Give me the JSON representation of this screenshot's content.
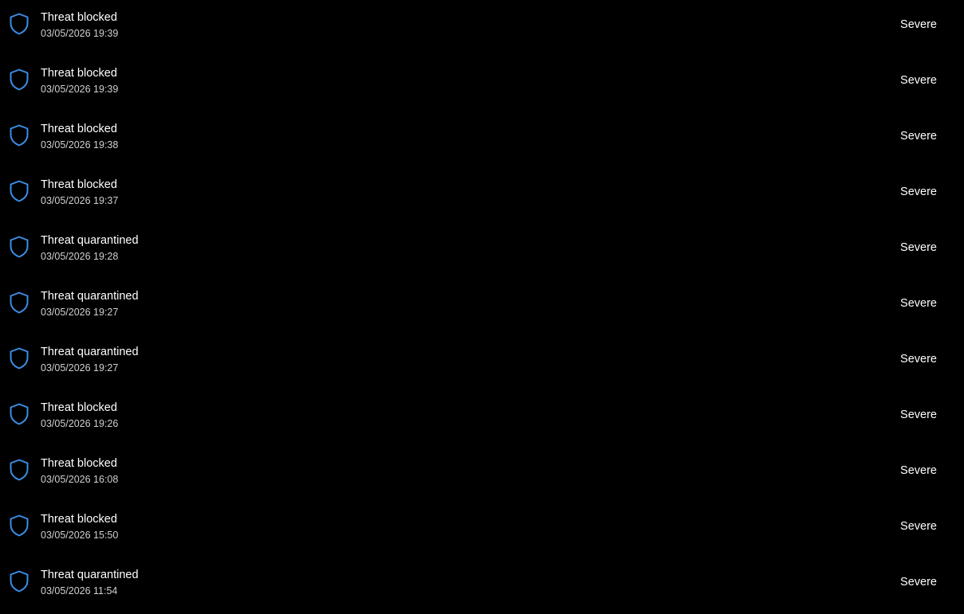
{
  "colors": {
    "background": "#000000",
    "text": "#ffffff",
    "subtext": "#d0d0d0",
    "shield": "#3a8ee6"
  },
  "history": {
    "items": [
      {
        "icon": "shield-icon",
        "title": "Threat blocked",
        "timestamp": "03/05/2026 19:39",
        "severity": "Severe"
      },
      {
        "icon": "shield-icon",
        "title": "Threat blocked",
        "timestamp": "03/05/2026 19:39",
        "severity": "Severe"
      },
      {
        "icon": "shield-icon",
        "title": "Threat blocked",
        "timestamp": "03/05/2026 19:38",
        "severity": "Severe"
      },
      {
        "icon": "shield-icon",
        "title": "Threat blocked",
        "timestamp": "03/05/2026 19:37",
        "severity": "Severe"
      },
      {
        "icon": "shield-icon",
        "title": "Threat quarantined",
        "timestamp": "03/05/2026 19:28",
        "severity": "Severe"
      },
      {
        "icon": "shield-icon",
        "title": "Threat quarantined",
        "timestamp": "03/05/2026 19:27",
        "severity": "Severe"
      },
      {
        "icon": "shield-icon",
        "title": "Threat quarantined",
        "timestamp": "03/05/2026 19:27",
        "severity": "Severe"
      },
      {
        "icon": "shield-icon",
        "title": "Threat blocked",
        "timestamp": "03/05/2026 19:26",
        "severity": "Severe"
      },
      {
        "icon": "shield-icon",
        "title": "Threat blocked",
        "timestamp": "03/05/2026 16:08",
        "severity": "Severe"
      },
      {
        "icon": "shield-icon",
        "title": "Threat blocked",
        "timestamp": "03/05/2026 15:50",
        "severity": "Severe"
      },
      {
        "icon": "shield-icon",
        "title": "Threat quarantined",
        "timestamp": "03/05/2026 11:54",
        "severity": "Severe"
      }
    ]
  }
}
